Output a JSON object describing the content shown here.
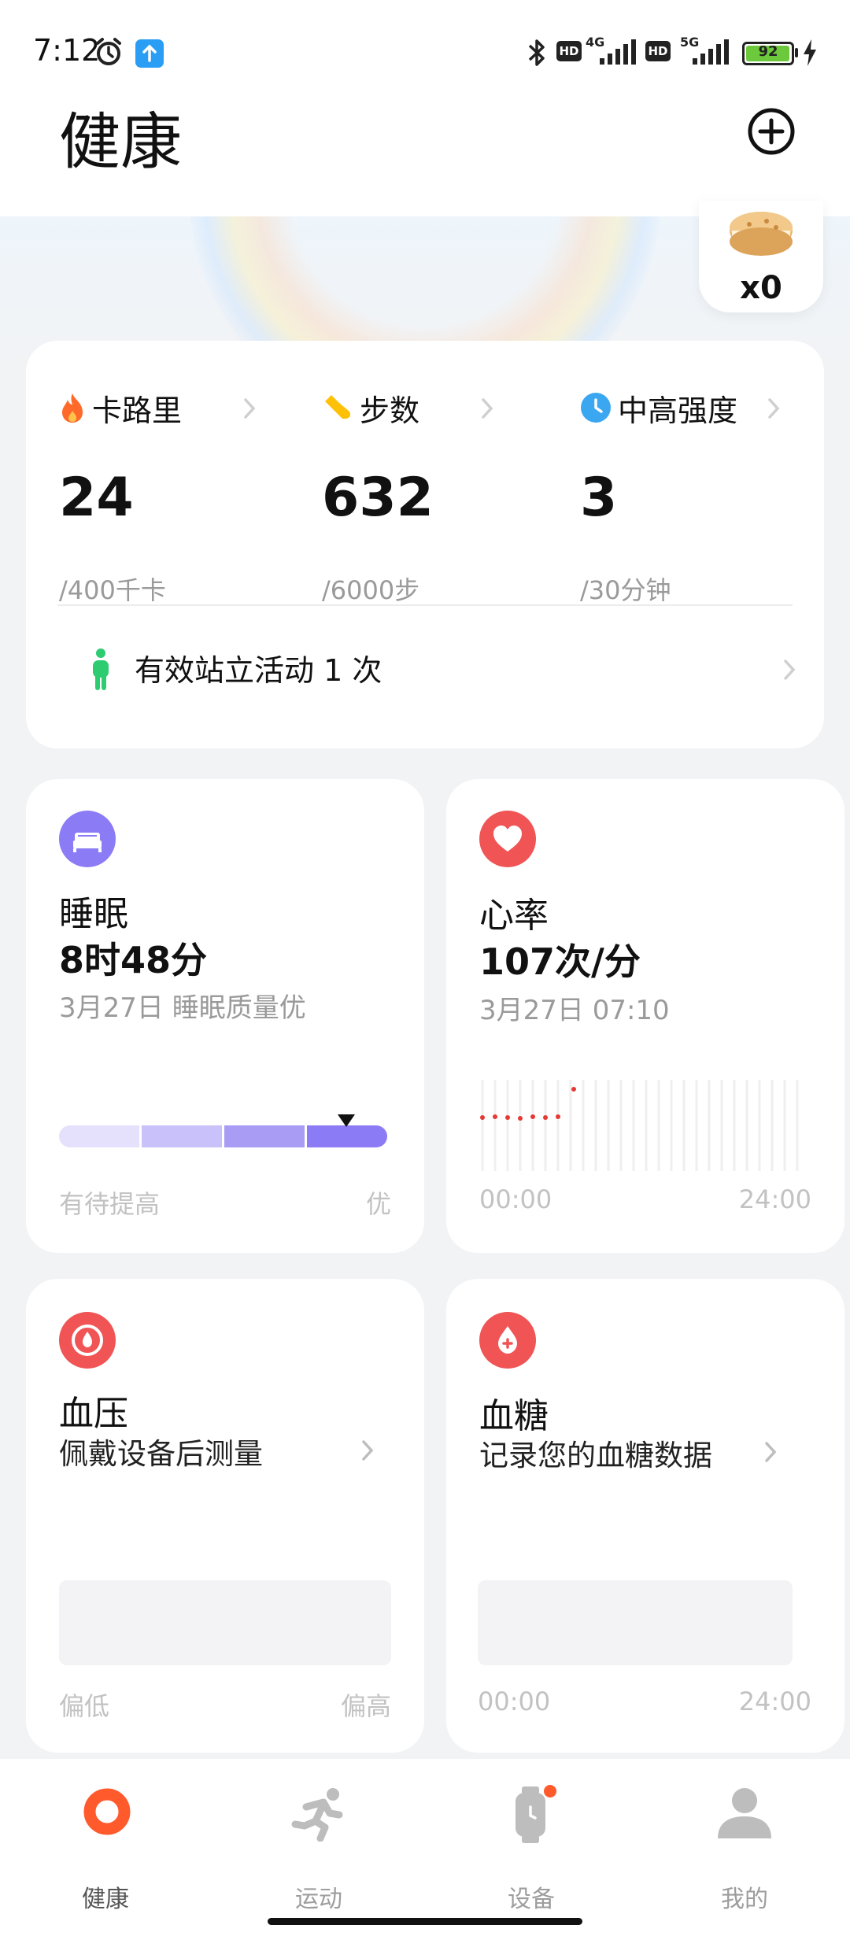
{
  "status_bar": {
    "time": "7:12",
    "battery": "92",
    "network_1": "4G",
    "network_2": "5G",
    "hd_label": "HD"
  },
  "header": {
    "title": "健康"
  },
  "reward": {
    "count": "x0"
  },
  "summary": {
    "metrics": [
      {
        "label": "卡路里",
        "value": "24",
        "goal": "/400千卡",
        "icon": "flame-icon",
        "color": "#ff6a2b"
      },
      {
        "label": "步数",
        "value": "632",
        "goal": "/6000步",
        "icon": "shoe-icon",
        "color": "#ffc107"
      },
      {
        "label": "中高强度",
        "value": "3",
        "goal": "/30分钟",
        "icon": "clock-icon",
        "color": "#3ba7f0"
      }
    ],
    "stand": {
      "text": "有效站立活动 1 次",
      "icon": "standing-person-icon",
      "color": "#2ecc71"
    }
  },
  "sleep": {
    "title": "睡眠",
    "value": "8时48分",
    "sub": "3月27日 睡眠质量优",
    "foot_left": "有待提高",
    "foot_right": "优",
    "quality_level": 4,
    "quality_max": 4,
    "icon": "bed-icon",
    "color": "#8b7cf6"
  },
  "heart": {
    "title": "心率",
    "value": "107次/分",
    "sub": "3月27日 07:10",
    "foot_left": "00:00",
    "foot_right": "24:00",
    "icon": "heart-icon",
    "color": "#f05454"
  },
  "blood_pressure": {
    "title": "血压",
    "desc": "佩戴设备后测量",
    "foot_left": "偏低",
    "foot_right": "偏高",
    "icon": "blood-pressure-icon",
    "color": "#f05454"
  },
  "blood_sugar": {
    "title": "血糖",
    "desc": "记录您的血糖数据",
    "foot_left": "00:00",
    "foot_right": "24:00",
    "icon": "blood-drop-icon",
    "color": "#f05454"
  },
  "tabs": [
    {
      "label": "健康",
      "icon": "health-ring-icon",
      "active": true
    },
    {
      "label": "运动",
      "icon": "running-icon",
      "active": false
    },
    {
      "label": "设备",
      "icon": "watch-icon",
      "active": false,
      "badge": true
    },
    {
      "label": "我的",
      "icon": "profile-icon",
      "active": false
    }
  ]
}
